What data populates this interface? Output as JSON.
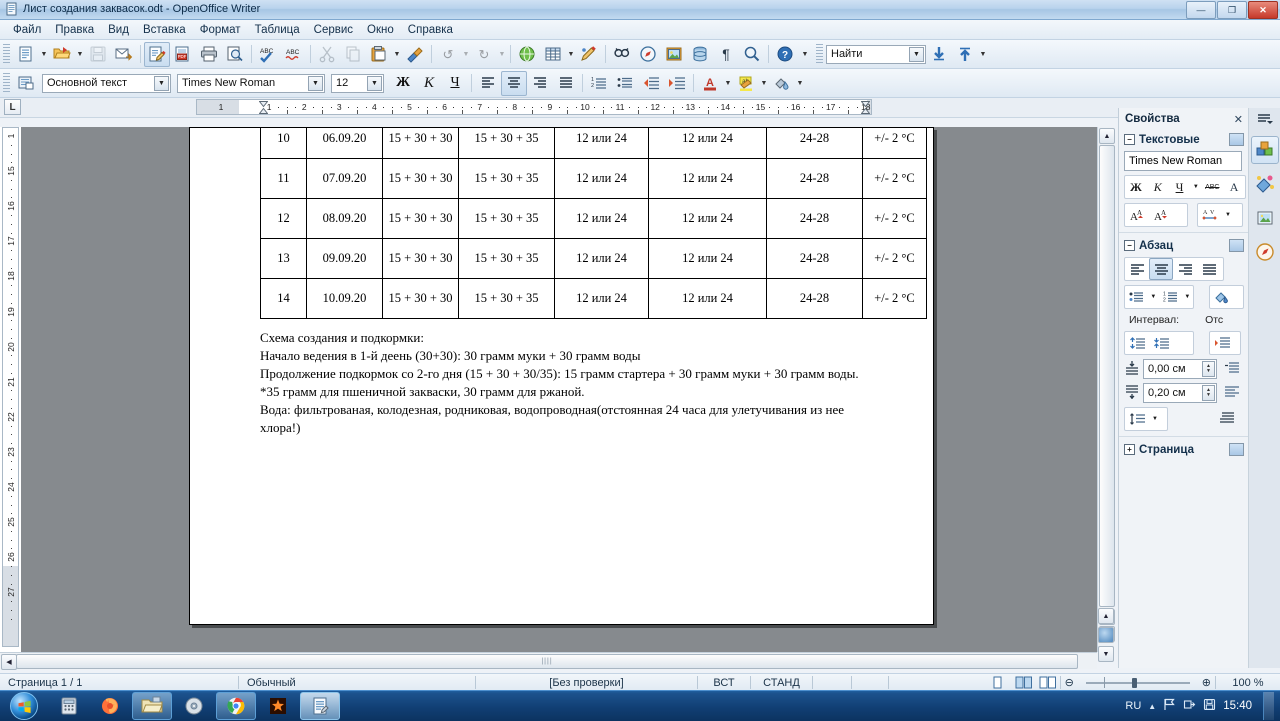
{
  "window": {
    "title": "Лист создания заквасок.odt - OpenOffice Writer",
    "buttons": {
      "minimize": "—",
      "restore": "❐",
      "close": "✕"
    }
  },
  "menubar": {
    "items": [
      {
        "label": "Файл",
        "accel": "Ф"
      },
      {
        "label": "Правка",
        "accel": "П"
      },
      {
        "label": "Вид",
        "accel": "В"
      },
      {
        "label": "Вставка",
        "accel": "а"
      },
      {
        "label": "Формат",
        "accel": "Ф"
      },
      {
        "label": "Таблица",
        "accel": "Т"
      },
      {
        "label": "Сервис",
        "accel": "е"
      },
      {
        "label": "Окно",
        "accel": "О"
      },
      {
        "label": "Справка",
        "accel": "С"
      }
    ]
  },
  "standard_toolbar": {
    "buttons": [
      {
        "name": "new-document",
        "glyph": "🗋",
        "has_dropdown": true
      },
      {
        "name": "open-document",
        "glyph": "📂",
        "has_dropdown": true
      },
      {
        "name": "save-document",
        "glyph": "💾",
        "has_dropdown": false
      },
      {
        "name": "email-document",
        "glyph": "✉",
        "has_dropdown": false
      },
      {
        "name": "edit-file",
        "glyph": "📝",
        "has_dropdown": false,
        "active": true
      },
      {
        "name": "export-pdf",
        "glyph": "📄",
        "has_dropdown": false
      },
      {
        "name": "print-file",
        "glyph": "🖨",
        "has_dropdown": false
      },
      {
        "name": "page-preview",
        "glyph": "🔍",
        "has_dropdown": false
      },
      {
        "name": "spelling",
        "glyph": "ABC",
        "has_dropdown": false
      },
      {
        "name": "autospellcheck",
        "glyph": "ABC",
        "has_dropdown": false
      },
      {
        "name": "cut",
        "glyph": "✂",
        "has_dropdown": false
      },
      {
        "name": "copy",
        "glyph": "⧉",
        "has_dropdown": false
      },
      {
        "name": "paste",
        "glyph": "📋",
        "has_dropdown": true
      },
      {
        "name": "clone-formatting",
        "glyph": "🖌",
        "has_dropdown": false
      },
      {
        "name": "undo",
        "glyph": "↺",
        "has_dropdown": true
      },
      {
        "name": "redo",
        "glyph": "↻",
        "has_dropdown": true
      },
      {
        "name": "hyperlink",
        "glyph": "🌐",
        "has_dropdown": false
      },
      {
        "name": "insert-table",
        "glyph": "▦",
        "has_dropdown": true
      },
      {
        "name": "show-draw-functions",
        "glyph": "✏",
        "has_dropdown": false
      },
      {
        "name": "find-and-replace",
        "glyph": "🔎",
        "has_dropdown": false
      },
      {
        "name": "navigator",
        "glyph": "🧭",
        "has_dropdown": false
      },
      {
        "name": "gallery",
        "glyph": "🖼",
        "has_dropdown": false
      },
      {
        "name": "data-sources",
        "glyph": "🗄",
        "has_dropdown": false
      },
      {
        "name": "formatting-marks",
        "glyph": "¶",
        "has_dropdown": false
      },
      {
        "name": "zoom",
        "glyph": "🔍",
        "has_dropdown": false
      },
      {
        "name": "help",
        "glyph": "?",
        "has_dropdown": false
      }
    ]
  },
  "find_toolbar": {
    "placeholder": "Найти",
    "value": "",
    "find_next_label": "⬇",
    "find_previous_label": "⬆"
  },
  "formatting_toolbar": {
    "paragraph_style": "Основной текст",
    "font_name": "Times New Roman",
    "font_size": "12",
    "bold_label": "Ж",
    "italic_label": "К",
    "underline_label": "Ч",
    "align": [
      "≡",
      "≡",
      "≡",
      "≡"
    ],
    "selected_align_index": 1
  },
  "ruler": {
    "tab_selector": "L",
    "horizontal_numbers": [
      1,
      1,
      2,
      3,
      4,
      5,
      6,
      7,
      8,
      9,
      10,
      11,
      12,
      13,
      14,
      15,
      16,
      17,
      18
    ],
    "vertical_numbers": [
      1,
      15,
      16,
      17,
      18,
      19,
      20,
      21,
      22,
      23,
      24,
      25,
      26,
      27
    ]
  },
  "document": {
    "table": {
      "rows": [
        {
          "n": "10",
          "date": "06.09.20",
          "c3": "15 + 30 + 30",
          "c4": "15 + 30 + 35",
          "c5": "12 или 24",
          "c6": "12 или 24",
          "c7": "24-28",
          "c8": "+/- 2 °C"
        },
        {
          "n": "11",
          "date": "07.09.20",
          "c3": "15 + 30 + 30",
          "c4": "15 + 30 + 35",
          "c5": "12 или 24",
          "c6": "12 или 24",
          "c7": "24-28",
          "c8": "+/- 2 °C"
        },
        {
          "n": "12",
          "date": "08.09.20",
          "c3": "15 + 30 + 30",
          "c4": "15 + 30 + 35",
          "c5": "12 или 24",
          "c6": "12 или 24",
          "c7": "24-28",
          "c8": "+/- 2 °C"
        },
        {
          "n": "13",
          "date": "09.09.20",
          "c3": "15 + 30 + 30",
          "c4": "15 + 30 + 35",
          "c5": "12 или 24",
          "c6": "12 или 24",
          "c7": "24-28",
          "c8": "+/- 2 °C"
        },
        {
          "n": "14",
          "date": "10.09.20",
          "c3": "15 + 30 + 30",
          "c4": "15 + 30 + 35",
          "c5": "12 или 24",
          "c6": "12 или 24",
          "c7": "24-28",
          "c8": "+/- 2 °C"
        }
      ]
    },
    "paragraphs": [
      "Схема создания и подкормки:",
      "Начало ведения в 1-й  деень (30+30): 30 грамм муки + 30 грамм воды",
      "Продолжение подкормок со 2-го дня  (15 + 30 + 30/35): 15 грамм стартера + 30 грамм муки + 30 грамм  воды. *35 грамм для пшеничной закваски, 30 грамм для ржаной.",
      "Вода: фильтрованая, колодезная, родниковая, водопроводная(отстоянная 24 часа для улетучивания из нее хлора!)"
    ]
  },
  "sidebar": {
    "title": "Свойства",
    "close_label": "✕",
    "sections": [
      {
        "title": "Текстовые",
        "expander": "−"
      },
      {
        "title": "Абзац",
        "expander": "−"
      },
      {
        "title": "Страница",
        "expander": "+"
      }
    ],
    "character": {
      "font_name": "Times New Roman",
      "bold": "Ж",
      "italic": "К",
      "underline": "Ч",
      "strikethrough": "ABC"
    },
    "paragraph": {
      "spacing_label": "Интервал:",
      "indent_label": "Отс",
      "spacing_above": "0,00 см",
      "spacing_below": "0,20 см",
      "selected_align_index": 1
    },
    "tabs": [
      {
        "name": "properties-deck",
        "glyph": "🧊",
        "selected": true
      },
      {
        "name": "styles-deck",
        "glyph": "🎨",
        "selected": false
      },
      {
        "name": "gallery-deck",
        "glyph": "🖼",
        "selected": false
      },
      {
        "name": "navigator-deck",
        "glyph": "🧭",
        "selected": false
      }
    ],
    "menu_glyph": "☰"
  },
  "statusbar": {
    "page": "Страница  1 / 1",
    "style": "Обычный",
    "language": "[Без проверки]",
    "insert_mode": "ВСТ",
    "selection_mode": "СТАНД",
    "view_layouts": [
      "▯",
      "▯▯",
      "▭"
    ],
    "zoom_out": "⊖",
    "zoom_in": "⊕",
    "zoom_value": "100 %"
  },
  "taskbar": {
    "start_label": "⊞",
    "items": [
      {
        "name": "calculator",
        "glyph": "🖩",
        "state": "pinned"
      },
      {
        "name": "firefox",
        "glyph": "🦊",
        "state": "pinned"
      },
      {
        "name": "file-explorer",
        "glyph": "🗂",
        "state": "open"
      },
      {
        "name": "media-player",
        "glyph": "💿",
        "state": "pinned"
      },
      {
        "name": "google-chrome",
        "glyph": "◉",
        "state": "open"
      },
      {
        "name": "image-viewer",
        "glyph": "✹",
        "state": "pinned"
      },
      {
        "name": "openoffice-writer",
        "glyph": "📄",
        "state": "active"
      }
    ],
    "tray": {
      "language": "RU",
      "expand": "▲",
      "icons": [
        "⚑",
        "🔌",
        "💾"
      ],
      "clock": "15:40"
    }
  }
}
